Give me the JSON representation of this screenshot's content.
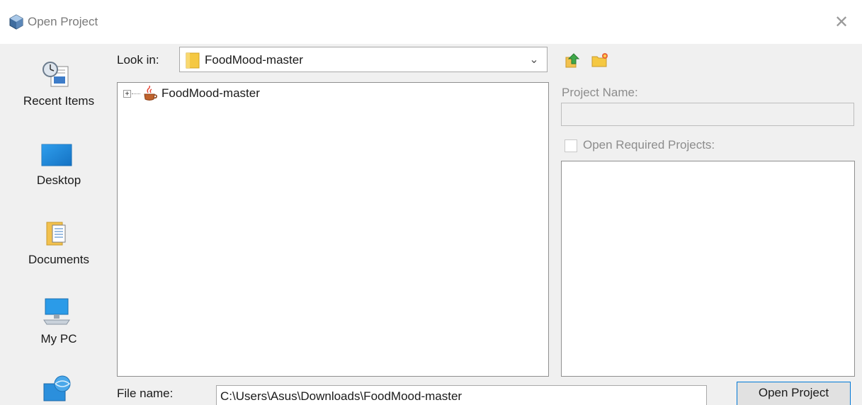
{
  "window": {
    "title": "Open Project",
    "close_glyph": "✕"
  },
  "places": {
    "items": [
      {
        "label": "Recent Items",
        "icon": "recent-items-icon"
      },
      {
        "label": "Desktop",
        "icon": "desktop-icon"
      },
      {
        "label": "Documents",
        "icon": "documents-icon"
      },
      {
        "label": "My PC",
        "icon": "computer-icon"
      },
      {
        "label": "",
        "icon": "network-icon"
      }
    ]
  },
  "lookin": {
    "label": "Look in:",
    "value": "FoodMood-master",
    "arrow": "⌄"
  },
  "toolbar": {
    "up_icon": "up-folder-icon",
    "new_icon": "new-folder-icon"
  },
  "tree": {
    "items": [
      {
        "label": "FoodMood-master",
        "expand": "+",
        "icon": "java-project-icon"
      }
    ]
  },
  "project": {
    "name_label": "Project Name:",
    "name_value": "",
    "required_label": "Open Required Projects:",
    "required_checked": false
  },
  "file": {
    "label": "File name:",
    "value": "C:\\Users\\Asus\\Downloads\\FoodMood-master"
  },
  "buttons": {
    "open_label": "Open Project"
  },
  "colors": {
    "accent": "#0078d7",
    "folder": "#f5c842",
    "background": "#f0f0f0"
  }
}
